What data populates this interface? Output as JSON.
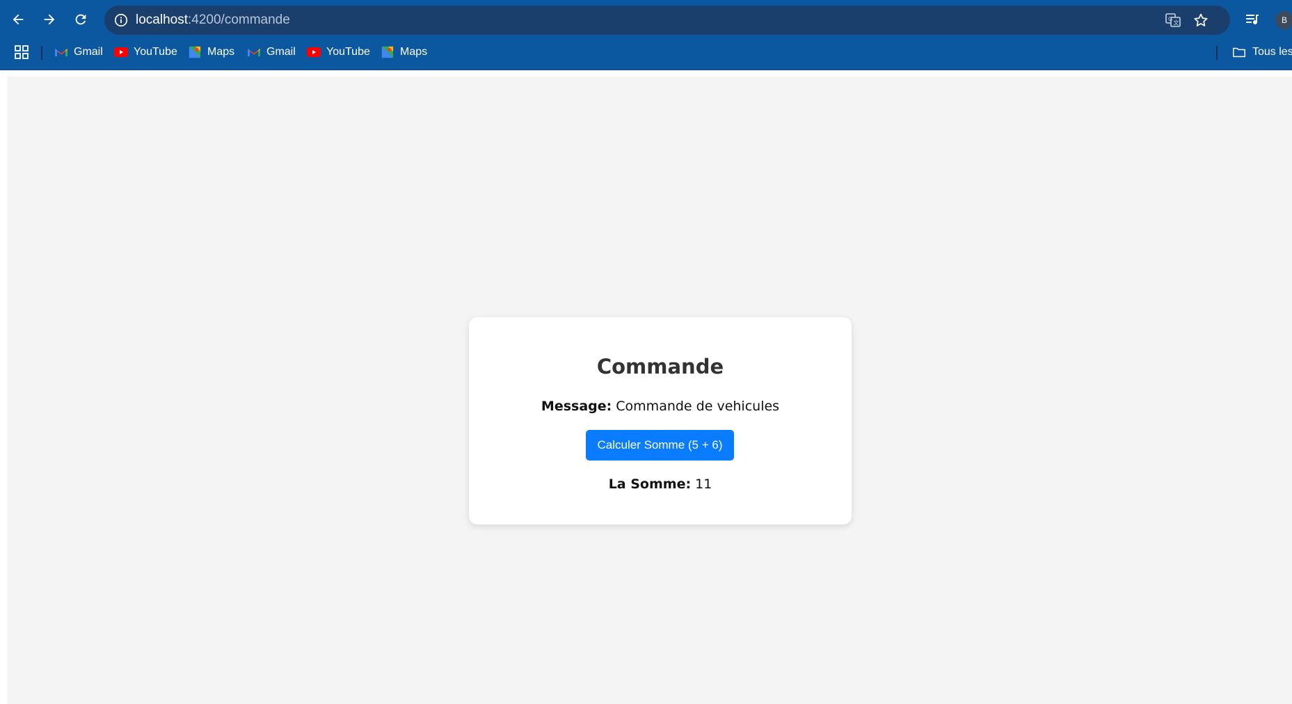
{
  "browser": {
    "url_host": "localhost",
    "url_path": ":4200/commande",
    "profile_initial": "B",
    "bookmarks": [
      {
        "label": "Gmail",
        "icon": "gmail-icon"
      },
      {
        "label": "YouTube",
        "icon": "youtube-icon"
      },
      {
        "label": "Maps",
        "icon": "maps-icon"
      },
      {
        "label": "Gmail",
        "icon": "gmail-icon"
      },
      {
        "label": "YouTube",
        "icon": "youtube-icon"
      },
      {
        "label": "Maps",
        "icon": "maps-icon"
      }
    ],
    "all_bookmarks_label": "Tous les"
  },
  "page": {
    "title": "Commande",
    "message_label": "Message:",
    "message_value": "Commande de vehicules",
    "button_label": "Calculer Somme (5 + 6)",
    "sum_label": "La Somme:",
    "sum_value": "11"
  },
  "colors": {
    "chrome_bg": "#0b57a0",
    "page_bg": "#f4f4f4",
    "button_bg": "#0a7cff"
  }
}
